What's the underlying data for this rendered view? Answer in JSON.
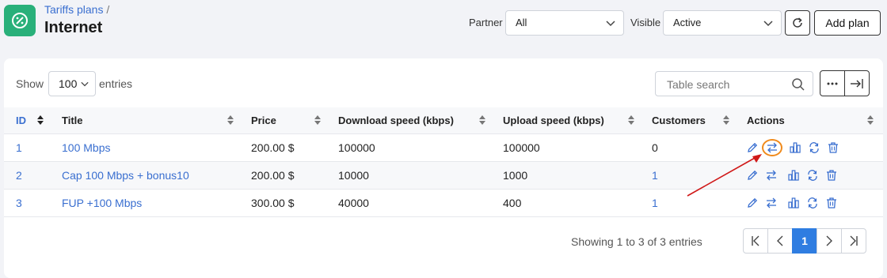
{
  "header": {
    "breadcrumb_link": "Tariffs plans",
    "breadcrumb_sep": "/",
    "title": "Internet",
    "partner_label": "Partner",
    "partner_value": "All",
    "visible_label": "Visible",
    "visible_value": "Active",
    "add_label": "Add plan",
    "app_icon": "percent-icon"
  },
  "toolbar": {
    "show_label": "Show",
    "entries_value": "100",
    "entries_label": "entries",
    "search_placeholder": "Table search"
  },
  "table": {
    "columns": [
      "ID",
      "Title",
      "Price",
      "Download speed (kbps)",
      "Upload speed (kbps)",
      "Customers",
      "Actions"
    ],
    "rows": [
      {
        "id": "1",
        "title": "100 Mbps",
        "price": "200.00 $",
        "download": "100000",
        "upload": "100000",
        "customers": "0"
      },
      {
        "id": "2",
        "title": "Cap 100 Mbps + bonus10",
        "price": "200.00 $",
        "download": "10000",
        "upload": "1000",
        "customers": "1"
      },
      {
        "id": "3",
        "title": "FUP +100 Mbps",
        "price": "300.00 $",
        "download": "40000",
        "upload": "400",
        "customers": "1"
      }
    ]
  },
  "footer": {
    "info": "Showing 1 to 3 of 3 entries",
    "current_page": "1"
  },
  "colors": {
    "accent": "#3a6fd0",
    "brand_green": "#29b07a",
    "highlight_orange": "#f08a1c",
    "annotation_red": "#d01818"
  }
}
